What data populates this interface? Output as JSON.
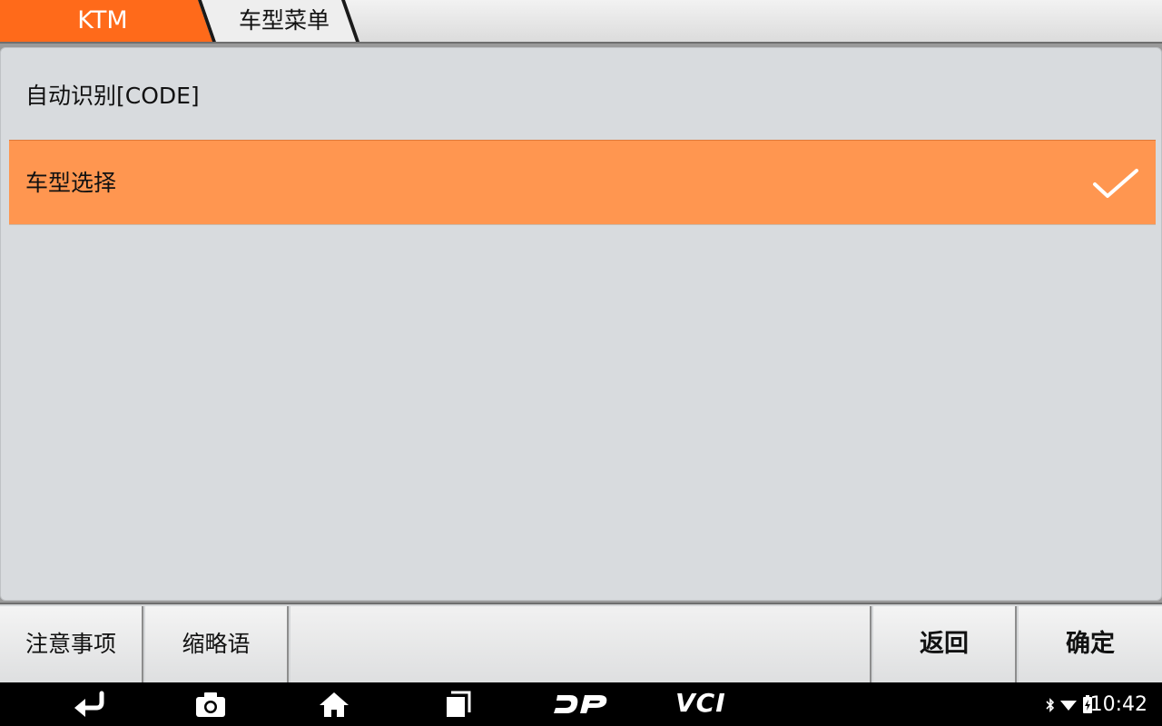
{
  "breadcrumb": {
    "root": "KTM",
    "current": "车型菜单"
  },
  "menu": {
    "items": [
      {
        "label": "自动识别[CODE]",
        "selected": false
      },
      {
        "label": "车型选择",
        "selected": true
      }
    ]
  },
  "toolbar": {
    "notes_label": "注意事项",
    "abbreviations_label": "缩略语",
    "back_label": "返回",
    "confirm_label": "确定"
  },
  "navbar": {
    "icons": [
      "back-icon",
      "camera-icon",
      "home-icon",
      "recents-icon",
      "dp-logo-icon",
      "vci-icon"
    ],
    "vci_label": "VCI"
  },
  "status": {
    "time": "10:42",
    "icons": [
      "bluetooth-icon",
      "wifi-icon",
      "battery-icon"
    ]
  },
  "colors": {
    "accent": "#ff6a1a",
    "selected_row": "#ff9650",
    "panel": "#d8dbde"
  }
}
